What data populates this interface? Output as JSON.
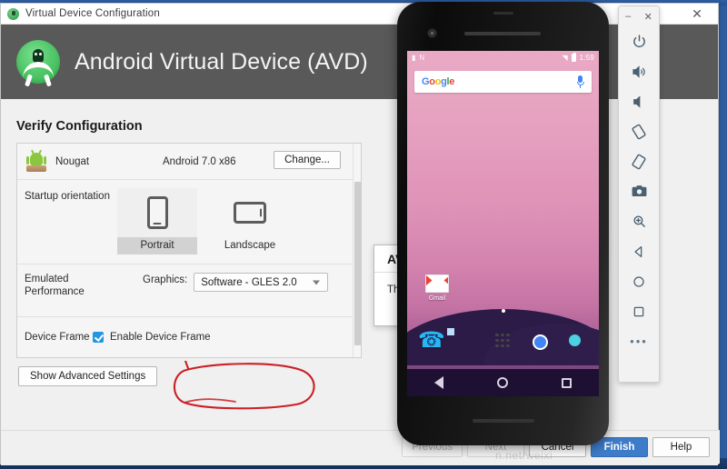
{
  "window": {
    "title": "Virtual Device Configuration",
    "title_icon": "android-head-icon",
    "close_label": "✕"
  },
  "banner": {
    "logo_icon": "android-studio-avd-logo",
    "title": "Android Virtual Device (AVD)"
  },
  "main": {
    "heading": "Verify Configuration",
    "system_image": {
      "icon": "bugdroid-statue-icon",
      "name": "Nougat",
      "api": "Android 7.0 x86",
      "change_button": "Change..."
    },
    "orientation": {
      "label": "Startup orientation",
      "options": [
        {
          "label": "Portrait",
          "icon": "phone-portrait-icon",
          "selected": true
        },
        {
          "label": "Landscape",
          "icon": "phone-landscape-icon",
          "selected": false
        }
      ]
    },
    "performance": {
      "label_line1": "Emulated",
      "label_line2": "Performance",
      "graphics_label": "Graphics:",
      "graphics_value": "Software - GLES 2.0",
      "caret_icon": "chevron-down-icon"
    },
    "device_frame": {
      "label": "Device Frame",
      "checkbox_label": "Enable Device Frame",
      "checked": true
    },
    "advanced_button": "Show Advanced Settings",
    "annotation": {
      "type": "hand-drawn-red-ellipse",
      "color": "#cc1f26",
      "target": "graphics-dropdown"
    }
  },
  "avd_dialog": {
    "title": "AV",
    "text": "Th"
  },
  "footer": {
    "buttons": [
      {
        "label": "Previous",
        "state": "disabled",
        "primary": false
      },
      {
        "label": "Next",
        "state": "disabled",
        "primary": false
      },
      {
        "label": "Cancel",
        "state": "enabled",
        "primary": false
      },
      {
        "label": "Finish",
        "state": "enabled",
        "primary": true
      },
      {
        "label": "Help",
        "state": "enabled",
        "primary": false
      }
    ],
    "watermark": "n.net/weixi"
  },
  "emulator": {
    "device": "Nexus 5X device frame",
    "status_bar": {
      "left_icons": [
        "sim-card-icon",
        "nfc-icon"
      ],
      "right_icons": [
        "wifi-icon",
        "battery-icon"
      ],
      "time": "1:59"
    },
    "search_widget": {
      "logo": "google-logo",
      "logo_letters": [
        "G",
        "o",
        "o",
        "g",
        "l",
        "e"
      ],
      "mic_icon": "microphone-icon"
    },
    "home_apps": [
      {
        "label": "Gmail",
        "icon": "gmail-icon"
      }
    ],
    "page_indicator_icon": "page-dot-icon",
    "dock": [
      {
        "label": "Phone",
        "icon": "phone-dialer-icon"
      },
      {
        "label": "Messenger",
        "icon": "messages-icon"
      },
      {
        "label": "Apps",
        "icon": "app-drawer-icon"
      },
      {
        "label": "Chrome",
        "icon": "chrome-icon"
      },
      {
        "label": "Photos",
        "icon": "photos-icon"
      }
    ],
    "nav_bar": [
      {
        "label": "Back",
        "icon": "nav-back-triangle-icon"
      },
      {
        "label": "Home",
        "icon": "nav-home-circle-icon"
      },
      {
        "label": "Overview",
        "icon": "nav-overview-square-icon"
      }
    ],
    "toolbar": {
      "minimize_label": "–",
      "close_label": "✕",
      "items": [
        {
          "name": "power-icon",
          "label": "Power"
        },
        {
          "name": "volume-up-icon",
          "label": "Volume Up"
        },
        {
          "name": "volume-down-icon",
          "label": "Volume Down"
        },
        {
          "name": "rotate-left-icon",
          "label": "Rotate Left"
        },
        {
          "name": "rotate-right-icon",
          "label": "Rotate Right"
        },
        {
          "name": "camera-icon",
          "label": "Take Screenshot"
        },
        {
          "name": "zoom-icon",
          "label": "Zoom Mode"
        },
        {
          "name": "back-icon",
          "label": "Back"
        },
        {
          "name": "home-icon",
          "label": "Home"
        },
        {
          "name": "overview-icon",
          "label": "Overview"
        },
        {
          "name": "more-icon",
          "label": "More"
        }
      ],
      "more_label": "•••"
    }
  },
  "colors": {
    "banner_bg": "#595959",
    "accent_blue": "#3d7cc9",
    "annotation_red": "#cc1f26",
    "checkbox_blue": "#2196e3"
  }
}
